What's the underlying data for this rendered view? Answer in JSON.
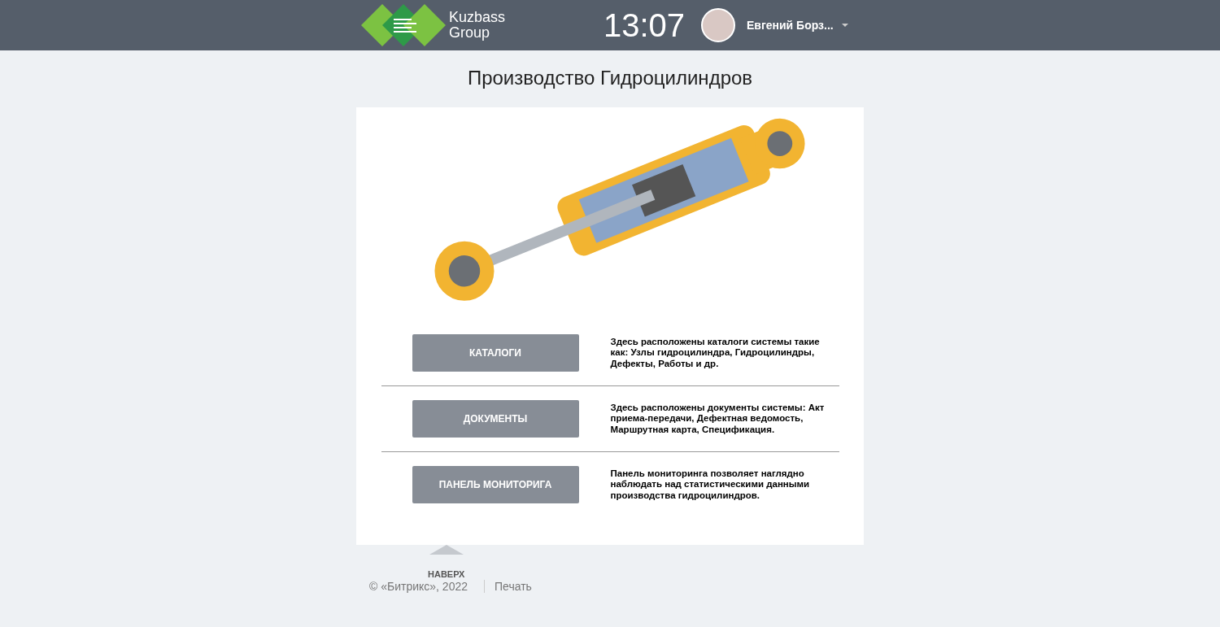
{
  "header": {
    "logo_text": [
      "Kuzbass",
      "Group"
    ],
    "clock": "13:07",
    "user": {
      "name": "Евгений Борз..."
    }
  },
  "page_title": "Производство Гидроцилиндров",
  "sections": [
    {
      "button": "КАТАЛОГИ",
      "description": "Здесь расположены каталоги системы такие как: Узлы гидроцилиндра, Гидроцилиндры, Дефекты, Работы и др."
    },
    {
      "button": "ДОКУМЕНТЫ",
      "description": "Здесь расположены документы системы: Акт приема-передачи, Дефектная ведомость, Маршрутная карта, Спецификация."
    },
    {
      "button": "ПАНЕЛЬ МОНИТОРИГА",
      "description": "Панель мониторинга позволяет наглядно наблюдать над статистическими данными производства гидроцилиндров."
    }
  ],
  "footer": {
    "to_top": "НАВЕРХ",
    "copyright": "© «Битрикс», 2022",
    "print": "Печать"
  }
}
